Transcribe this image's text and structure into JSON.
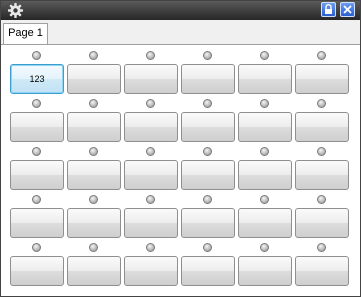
{
  "titlebar": {
    "menu_icon": "gear-icon",
    "lock_icon": "lock-icon",
    "close_icon": "close-icon"
  },
  "tabs": [
    {
      "label": "Page 1",
      "selected": true
    }
  ],
  "grid": {
    "rows": [
      [
        {
          "label": "123",
          "active": true
        },
        {
          "label": ""
        },
        {
          "label": ""
        },
        {
          "label": ""
        },
        {
          "label": ""
        },
        {
          "label": ""
        }
      ],
      [
        {
          "label": ""
        },
        {
          "label": ""
        },
        {
          "label": ""
        },
        {
          "label": ""
        },
        {
          "label": ""
        },
        {
          "label": ""
        }
      ],
      [
        {
          "label": ""
        },
        {
          "label": ""
        },
        {
          "label": ""
        },
        {
          "label": ""
        },
        {
          "label": ""
        },
        {
          "label": ""
        }
      ],
      [
        {
          "label": ""
        },
        {
          "label": ""
        },
        {
          "label": ""
        },
        {
          "label": ""
        },
        {
          "label": ""
        },
        {
          "label": ""
        }
      ],
      [
        {
          "label": ""
        },
        {
          "label": ""
        },
        {
          "label": ""
        },
        {
          "label": ""
        },
        {
          "label": ""
        },
        {
          "label": ""
        }
      ]
    ]
  }
}
